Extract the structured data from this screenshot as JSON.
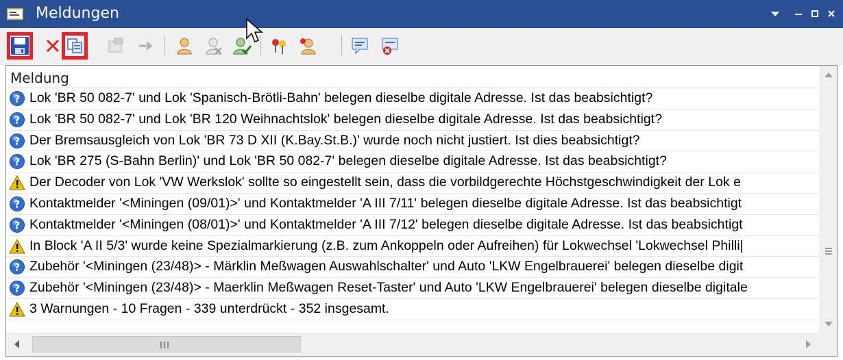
{
  "window": {
    "title": "Meldungen",
    "icons": [
      "menu-arrow-icon",
      "minimize-icon",
      "maximize-icon",
      "close-icon"
    ]
  },
  "toolbar": {
    "buttons": [
      {
        "name": "save-button",
        "icon": "floppy-icon",
        "highlighted": true
      },
      {
        "name": "delete-button",
        "icon": "red-x-icon"
      },
      {
        "name": "copy-button",
        "icon": "copy-icon",
        "highlighted": true
      },
      {
        "name": "properties-button",
        "icon": "properties-icon",
        "disabled": true
      },
      {
        "name": "goto-button",
        "icon": "arrow-right-icon",
        "disabled": true
      },
      {
        "name": "user-button",
        "icon": "user-icon"
      },
      {
        "name": "user-remove-button",
        "icon": "user-remove-icon"
      },
      {
        "name": "user-check-button",
        "icon": "user-check-icon"
      },
      {
        "name": "filter-markers-button",
        "icon": "pins-icon"
      },
      {
        "name": "filter-user-button",
        "icon": "user-pin-icon"
      },
      {
        "name": "message-button",
        "icon": "message-icon"
      },
      {
        "name": "message-delete-button",
        "icon": "message-delete-icon"
      }
    ]
  },
  "list": {
    "column_header": "Meldung",
    "rows": [
      {
        "type": "question",
        "text": "Lok 'BR 50 082-7' und Lok 'Spanisch-Brötli-Bahn' belegen dieselbe digitale Adresse. Ist das beabsichtigt?"
      },
      {
        "type": "question",
        "text": "Lok 'BR 50 082-7' und Lok 'BR 120 Weihnachtslok' belegen dieselbe digitale Adresse. Ist das beabsichtigt?"
      },
      {
        "type": "question",
        "text": "Der Bremsausgleich von Lok 'BR 73 D XII (K.Bay.St.B.)' wurde noch nicht justiert. Ist dies beabsichtigt?"
      },
      {
        "type": "question",
        "text": "Lok 'BR 275 (S-Bahn Berlin)' und Lok 'BR 50 082-7' belegen dieselbe digitale Adresse. Ist das beabsichtigt?"
      },
      {
        "type": "warning",
        "text": "Der Decoder von Lok 'VW Werkslok' sollte so eingestellt sein, dass die vorbildgerechte Höchstgeschwindigkeit der Lok e"
      },
      {
        "type": "question",
        "text": "Kontaktmelder '<Miningen (09/01)>' und Kontaktmelder 'A III 7/11' belegen dieselbe digitale Adresse. Ist das beabsichtigt"
      },
      {
        "type": "question",
        "text": "Kontaktmelder '<Miningen (08/01)>' und Kontaktmelder 'A III 7/12' belegen dieselbe digitale Adresse. Ist das beabsichtigt"
      },
      {
        "type": "warning",
        "text": "In Block 'A II 5/3' wurde keine Spezialmarkierung (z.B. zum Ankoppeln oder Aufreihen) für Lokwechsel 'Lokwechsel Philli|"
      },
      {
        "type": "question",
        "text": "Zubehör '<Miningen (23/48)> - Märklin Meßwagen Auswahlschalter' und Auto 'LKW Engelbrauerei' belegen dieselbe digit"
      },
      {
        "type": "question",
        "text": "Zubehör '<Miningen (23/48)> - Maerklin Meßwagen Reset-Taster' und Auto 'LKW Engelbrauerei' belegen dieselbe digitale"
      },
      {
        "type": "warning",
        "text": "3 Warnungen - 10 Fragen - 339 unterdrückt - 352 insgesamt."
      }
    ]
  },
  "colors": {
    "titlebar": "#2b4f97",
    "highlight": "#e8202a",
    "question": "#2f6fd0",
    "warning": "#f2c200"
  }
}
